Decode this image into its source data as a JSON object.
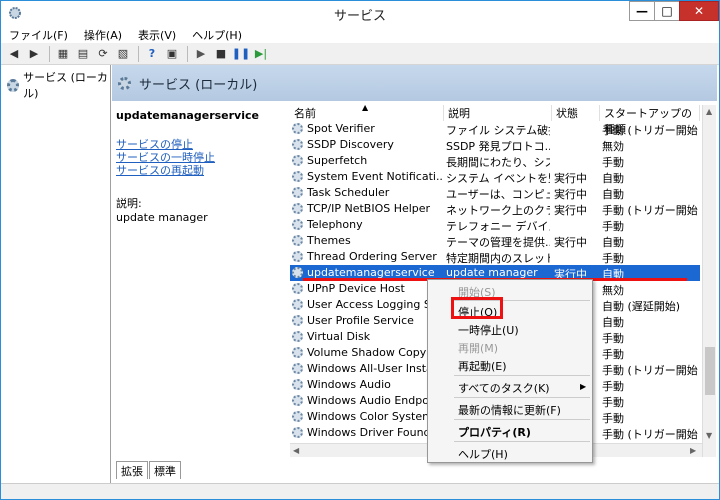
{
  "window": {
    "title": "サービス"
  },
  "menu": [
    "ファイル(F)",
    "操作(A)",
    "表示(V)",
    "ヘルプ(H)"
  ],
  "tree": {
    "root": "サービス (ローカル)"
  },
  "panel": {
    "header": "サービス (ローカル)"
  },
  "detail": {
    "service_name": "updatemanagerservice",
    "links": [
      "サービスの停止",
      "サービスの一時停止",
      "サービスの再起動"
    ],
    "desc_label": "説明:",
    "desc_value": "update manager"
  },
  "columns": {
    "name": "名前",
    "desc": "説明",
    "status": "状態",
    "startup": "スタートアップの種類"
  },
  "rows": [
    {
      "name": "Spot Verifier",
      "desc": "ファイル システム破損...",
      "status": "",
      "startup": "手動 (トリガー開始)"
    },
    {
      "name": "SSDP Discovery",
      "desc": "SSDP 発見プロトコ...",
      "status": "",
      "startup": "無効"
    },
    {
      "name": "Superfetch",
      "desc": "長期間にわたり、シス...",
      "status": "",
      "startup": "手動"
    },
    {
      "name": "System Event Notificati...",
      "desc": "システム イベントを監...",
      "status": "実行中",
      "startup": "自動"
    },
    {
      "name": "Task Scheduler",
      "desc": "ユーザーは、コンピュー...",
      "status": "実行中",
      "startup": "自動"
    },
    {
      "name": "TCP/IP NetBIOS Helper",
      "desc": "ネットワーク上のクライ...",
      "status": "実行中",
      "startup": "手動 (トリガー開始)"
    },
    {
      "name": "Telephony",
      "desc": "テレフォニー デバイス...",
      "status": "",
      "startup": "手動"
    },
    {
      "name": "Themes",
      "desc": "テーマの管理を提供...",
      "status": "実行中",
      "startup": "自動"
    },
    {
      "name": "Thread Ordering Server",
      "desc": "特定期間内のスレッド...",
      "status": "",
      "startup": "手動"
    },
    {
      "name": "updatemanagerservice",
      "desc": "update manager",
      "status": "実行中",
      "startup": "自動"
    },
    {
      "name": "UPnP Device Host",
      "desc": "",
      "status": "",
      "startup": "無効"
    },
    {
      "name": "User Access Logging Ser",
      "desc": "",
      "status": "",
      "startup": "自動 (遅延開始)"
    },
    {
      "name": "User Profile Service",
      "desc": "",
      "status": "",
      "startup": "自動"
    },
    {
      "name": "Virtual Disk",
      "desc": "",
      "status": "",
      "startup": "手動"
    },
    {
      "name": "Volume Shadow Copy",
      "desc": "",
      "status": "",
      "startup": "手動"
    },
    {
      "name": "Windows All-User Install",
      "desc": "",
      "status": "",
      "startup": "手動 (トリガー開始)"
    },
    {
      "name": "Windows Audio",
      "desc": "",
      "status": "",
      "startup": "手動"
    },
    {
      "name": "Windows Audio Endpoint",
      "desc": "",
      "status": "",
      "startup": "手動"
    },
    {
      "name": "Windows Color System",
      "desc": "",
      "status": "",
      "startup": "手動"
    },
    {
      "name": "Windows Driver Foundat",
      "desc": "",
      "status": "",
      "startup": "手動 (トリガー開始)"
    }
  ],
  "selected_index": 9,
  "context_menu": {
    "start": "開始(S)",
    "stop": "停止(O)",
    "pause": "一時停止(U)",
    "resume": "再開(M)",
    "restart": "再起動(E)",
    "all_tasks": "すべてのタスク(K)",
    "refresh": "最新の情報に更新(F)",
    "properties": "プロパティ(R)",
    "help": "ヘルプ(H)"
  },
  "tabs": [
    "拡張",
    "標準"
  ],
  "colors": {
    "selection": "#1b68d2",
    "highlight": "#e11111",
    "header": "#c6d8ec"
  }
}
